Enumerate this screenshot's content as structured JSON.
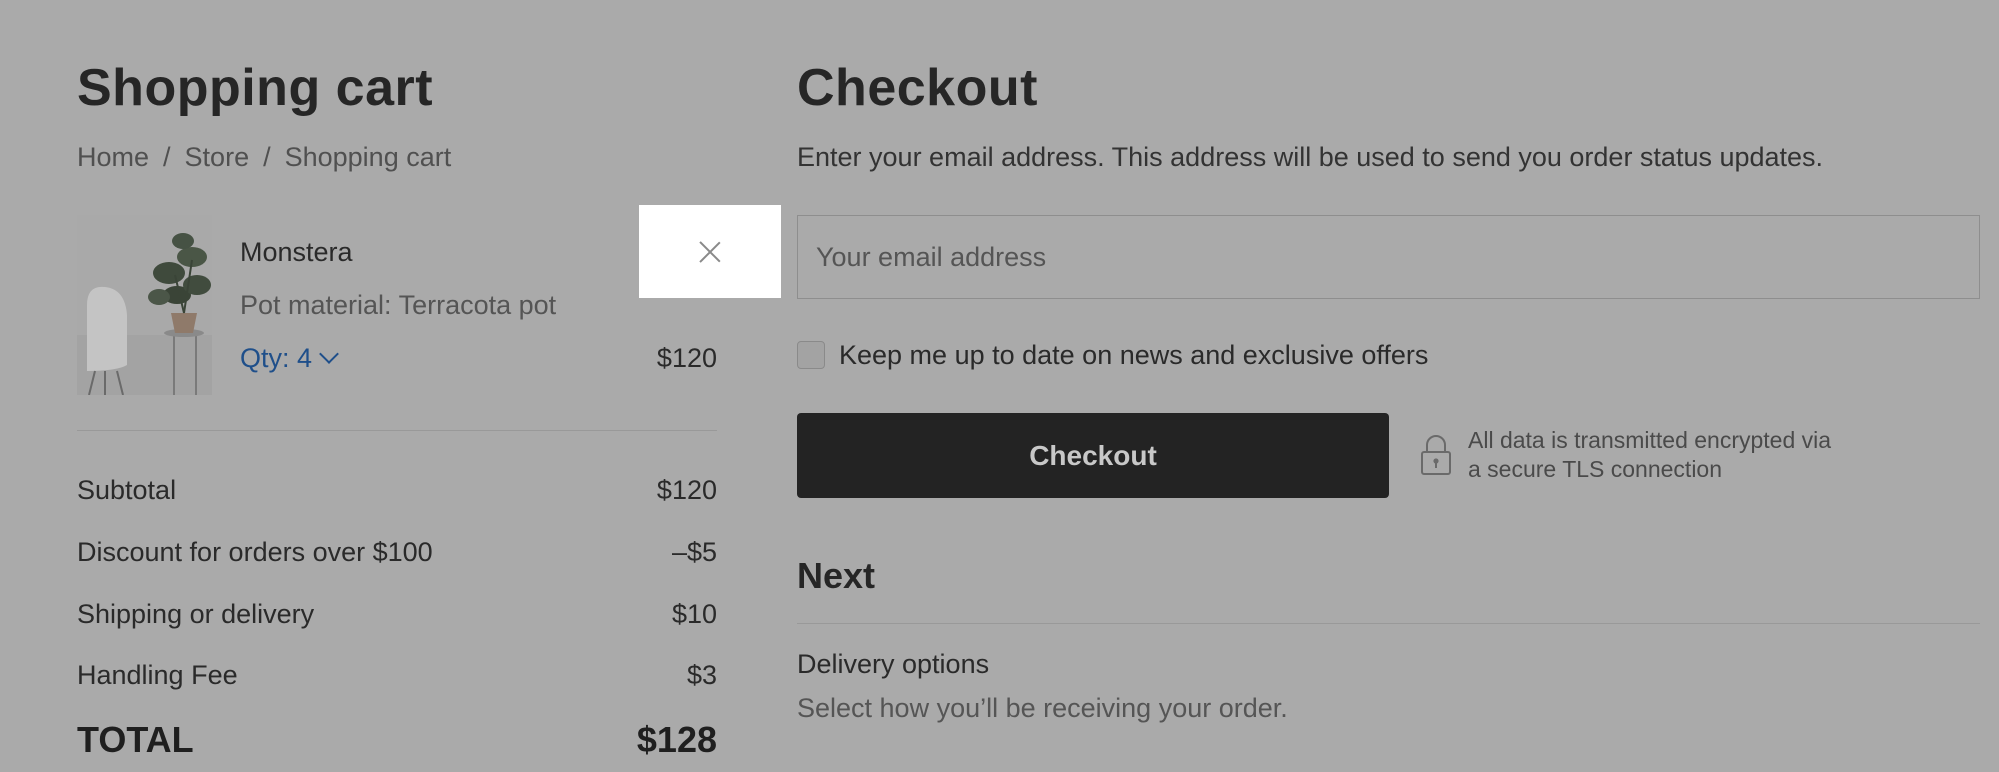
{
  "cart": {
    "title": "Shopping cart",
    "breadcrumb": [
      "Home",
      "Store",
      "Shopping cart"
    ],
    "item": {
      "name": "Monstera",
      "variant": "Pot material: Terracota pot",
      "qty": "Qty: 4",
      "price": "$120",
      "image_icon": "plant-photo"
    },
    "summary": [
      {
        "label": "Subtotal",
        "value": "$120"
      },
      {
        "label": "Discount for orders over $100",
        "value": "–$5"
      },
      {
        "label": "Shipping or delivery",
        "value": "$10"
      },
      {
        "label": "Handling Fee",
        "value": "$3"
      }
    ],
    "total": {
      "label": "TOTAL",
      "value": "$128"
    }
  },
  "checkout": {
    "title": "Checkout",
    "description": "Enter your email address. This address will be used to send you order status updates.",
    "email_placeholder": "Your email address",
    "newsletter_label": "Keep me up to date on news and exclusive offers",
    "button_label": "Checkout",
    "secure_line1": "All data is transmitted encrypted via",
    "secure_line2": "a secure TLS connection",
    "next_title": "Next",
    "delivery_title": "Delivery options",
    "delivery_desc": "Select how you’ll be receiving your order."
  },
  "colors": {
    "overlay_bg": "#aaaaaa",
    "button_bg": "#232323",
    "link_accent": "#1f4f8a"
  }
}
